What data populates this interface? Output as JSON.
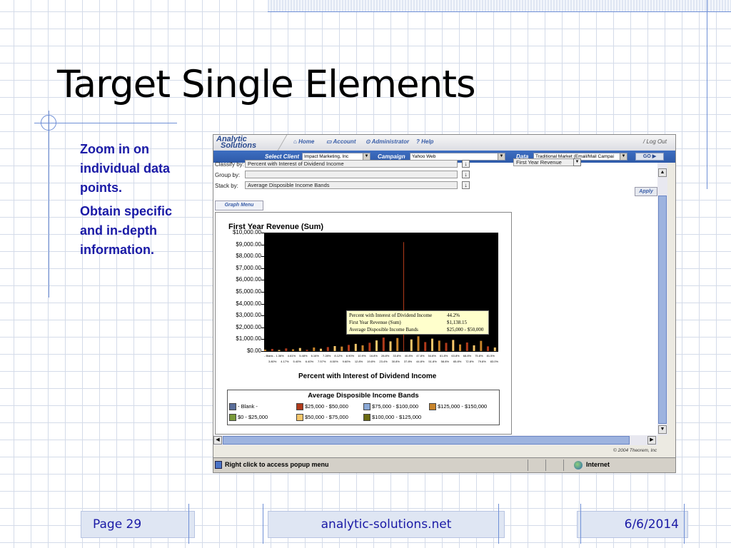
{
  "slide": {
    "title": "Target Single Elements",
    "bullets": [
      "Zoom in on individual data points.",
      "Obtain specific and in-depth information."
    ],
    "footer": {
      "page": "Page 29",
      "site": "analytic-solutions.net",
      "date": "6/6/2014"
    },
    "colors": {
      "bullet_text": "#1a1aa6",
      "grid": "#d4dbe9",
      "accent_line": "#6f8fd6"
    }
  },
  "app": {
    "logo_line1": "Analytic",
    "logo_line2": "Solutions",
    "nav": {
      "home": "Home",
      "account": "Account",
      "administrator": "Administrator",
      "help": "Help",
      "logout": "Log Out"
    },
    "toolbar": {
      "select_client_label": "Select Client",
      "client_value": "Impact Marketing, Inc",
      "campaign_label": "Campaign",
      "campaign_value": "Yahoo Web",
      "data_label": "Data",
      "data_value": "Traditional Market (Email/Mail Campai",
      "go_label": "GO"
    },
    "form": {
      "classify_label": "Classify by:",
      "classify_value": "Percent with Interest of Dividend Income",
      "group_label": "Group by:",
      "group_value": "",
      "stack_label": "Stack by:",
      "stack_value": "Average Disposible Income Bands",
      "measure_value": "First Year Revenue",
      "apply_label": "Apply",
      "graph_menu_label": "Graph Menu"
    },
    "tooltip": {
      "rows": [
        {
          "label": "Percent with Interest of Dividend Income",
          "value": "44.2%"
        },
        {
          "label": "First Year Revenue (Sum)",
          "value": "$1,138.15"
        },
        {
          "label": "Average Disposible Income Bands",
          "value": "$25,000 - $50,000"
        }
      ]
    },
    "legend": {
      "title": "Average Disposible Income Bands",
      "items": [
        {
          "label": "- Blank -",
          "color": "#5a6e9a"
        },
        {
          "label": "$25,000 - $50,000",
          "color": "#b03a1a"
        },
        {
          "label": "$75,000 - $100,000",
          "color": "#8aa8d6"
        },
        {
          "label": "$125,000 - $150,000",
          "color": "#c8842a"
        },
        {
          "label": "$0 - $25,000",
          "color": "#7a9a3a"
        },
        {
          "label": "$50,000 - $75,000",
          "color": "#f6c66a"
        },
        {
          "label": "$100,000 - $125,000",
          "color": "#6a6a12"
        }
      ]
    },
    "copyright": "© 2004 Theorem, Inc",
    "status": {
      "text": "Right click to access popup menu",
      "zone": "Internet"
    }
  },
  "chart_data": {
    "type": "bar",
    "title": "First Year Revenue (Sum)",
    "xlabel": "Percent with Interest of Dividend Income",
    "ylabel": "",
    "ylim": [
      0,
      10000
    ],
    "yticks": [
      "$10,000.00",
      "$9,000.00",
      "$8,000.00",
      "$7,000.00",
      "$6,000.00",
      "$5,000.00",
      "$4,000.00",
      "$3,000.00",
      "$2,000.00",
      "$1,000.00",
      "$0.00"
    ],
    "xticks_upper": [
      "- Blank -",
      "1.36%",
      "4.61%",
      "5.48%",
      "6.16%",
      "7.28%",
      "8.12%",
      "8.90%",
      "10.9%",
      "16.8%",
      "28.8%",
      "33.8%",
      "40.8%",
      "47.8%",
      "54.8%",
      "61.8%",
      "63.8%",
      "68.8%",
      "75.8%",
      "81.5%"
    ],
    "xticks_lower": [
      "3.80%",
      "4.17%",
      "5.40%",
      "6.40%",
      "7.57%",
      "8.50%",
      "9.60%",
      "12.8%",
      "19.8%",
      "23.4%",
      "30.8%",
      "37.8%",
      "44.8%",
      "51.8%",
      "58.8%",
      "65.8%",
      "72.8%",
      "79.8%",
      "83.0%"
    ],
    "bars": [
      {
        "x": 0.0,
        "value": 120,
        "band": 3
      },
      {
        "x": 0.03,
        "value": 180,
        "band": 1
      },
      {
        "x": 0.06,
        "value": 90,
        "band": 5
      },
      {
        "x": 0.09,
        "value": 220,
        "band": 1
      },
      {
        "x": 0.12,
        "value": 150,
        "band": 3
      },
      {
        "x": 0.15,
        "value": 260,
        "band": 5
      },
      {
        "x": 0.18,
        "value": 110,
        "band": 1
      },
      {
        "x": 0.21,
        "value": 300,
        "band": 3
      },
      {
        "x": 0.24,
        "value": 200,
        "band": 5
      },
      {
        "x": 0.27,
        "value": 340,
        "band": 1
      },
      {
        "x": 0.3,
        "value": 420,
        "band": 5
      },
      {
        "x": 0.33,
        "value": 380,
        "band": 3
      },
      {
        "x": 0.36,
        "value": 520,
        "band": 1
      },
      {
        "x": 0.39,
        "value": 610,
        "band": 5
      },
      {
        "x": 0.42,
        "value": 480,
        "band": 3
      },
      {
        "x": 0.45,
        "value": 700,
        "band": 1
      },
      {
        "x": 0.48,
        "value": 900,
        "band": 5
      },
      {
        "x": 0.51,
        "value": 1138.15,
        "band": 1
      },
      {
        "x": 0.54,
        "value": 820,
        "band": 5
      },
      {
        "x": 0.57,
        "value": 1100,
        "band": 3
      },
      {
        "x": 0.6,
        "value": 9200,
        "band": 1
      },
      {
        "x": 0.63,
        "value": 980,
        "band": 5
      },
      {
        "x": 0.66,
        "value": 1250,
        "band": 3
      },
      {
        "x": 0.69,
        "value": 760,
        "band": 1
      },
      {
        "x": 0.72,
        "value": 1050,
        "band": 5
      },
      {
        "x": 0.75,
        "value": 880,
        "band": 3
      },
      {
        "x": 0.78,
        "value": 690,
        "band": 1
      },
      {
        "x": 0.81,
        "value": 940,
        "band": 5
      },
      {
        "x": 0.84,
        "value": 560,
        "band": 3
      },
      {
        "x": 0.87,
        "value": 720,
        "band": 1
      },
      {
        "x": 0.9,
        "value": 480,
        "band": 5
      },
      {
        "x": 0.93,
        "value": 860,
        "band": 3
      },
      {
        "x": 0.96,
        "value": 400,
        "band": 1
      },
      {
        "x": 0.99,
        "value": 300,
        "band": 5
      }
    ]
  }
}
